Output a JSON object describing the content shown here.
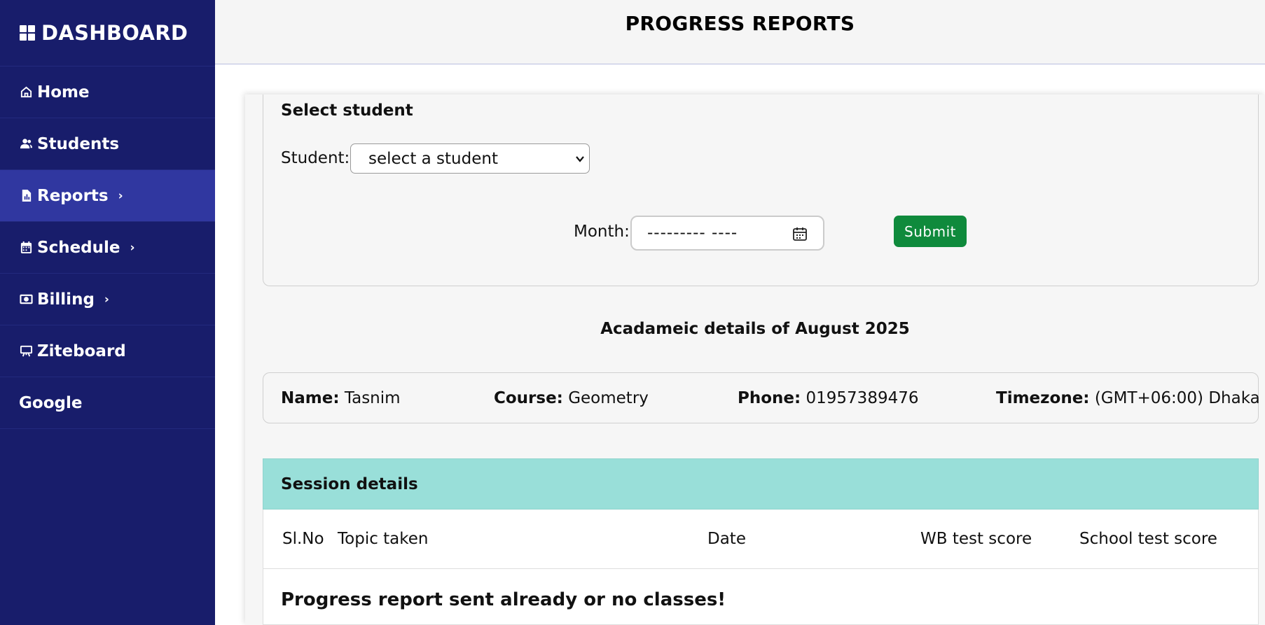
{
  "sidebar": {
    "brand": "DASHBOARD",
    "items": [
      {
        "label": "Home",
        "icon": "home-icon"
      },
      {
        "label": "Students",
        "icon": "users-icon"
      },
      {
        "label": "Reports",
        "icon": "report-icon",
        "chevron": "›",
        "active": true
      },
      {
        "label": "Schedule",
        "icon": "calendar-icon",
        "chevron": "›"
      },
      {
        "label": "Billing",
        "icon": "money-icon",
        "chevron": "›"
      },
      {
        "label": "Ziteboard",
        "icon": "whiteboard-icon"
      },
      {
        "label": "oogle",
        "prefix": "G"
      }
    ]
  },
  "header": {
    "title": "PROGRESS REPORTS"
  },
  "select_student": {
    "title": "Select student",
    "student_label": "Student:",
    "student_value": "select a student",
    "month_label": "Month:",
    "month_value": "--------- ----",
    "submit_label": "Submit"
  },
  "academic": {
    "title": "Acadameic details of August 2025"
  },
  "info": {
    "name_label": "Name:",
    "name_value": "Tasnim",
    "course_label": "Course:",
    "course_value": "Geometry",
    "phone_label": "Phone:",
    "phone_value": "01957389476",
    "timezone_label": "Timezone:",
    "timezone_value": "(GMT+06:00) Dhaka"
  },
  "session": {
    "title": "Session details",
    "columns": [
      "Sl.No",
      "Topic taken",
      "Date",
      "WB test score",
      "School test score"
    ],
    "empty_message": "Progress report sent already or no classes!"
  },
  "colors": {
    "sidebar_bg": "#181d6b",
    "sidebar_active": "#3037a0",
    "submit_bg": "#0f8a3c",
    "session_header_bg": "#99dfd9"
  }
}
